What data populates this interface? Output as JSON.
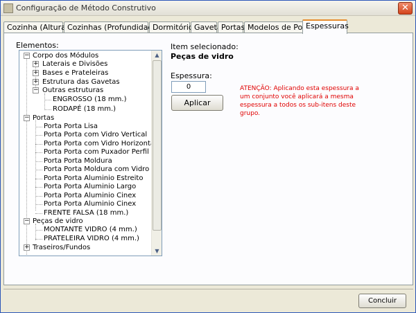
{
  "window": {
    "title": "Configuração de Método Construtivo",
    "close_glyph": "✕"
  },
  "tabs": [
    {
      "label": "Cozinha (Alturas)",
      "active": false
    },
    {
      "label": "Cozinhas (Profundidades)",
      "active": false
    },
    {
      "label": "Dormitórios",
      "active": false
    },
    {
      "label": "Gaveta",
      "active": false
    },
    {
      "label": "Portas",
      "active": false
    },
    {
      "label": "Modelos de Porta",
      "active": false
    },
    {
      "label": "Espessuras",
      "active": true
    }
  ],
  "elements": {
    "label": "Elementos:",
    "tree": [
      {
        "label": "Corpo dos Módulos",
        "expander": "−"
      },
      {
        "label": "Laterais e Divisões",
        "expander": "+"
      },
      {
        "label": "Bases e Prateleiras",
        "expander": "+"
      },
      {
        "label": "Estrutura das Gavetas",
        "expander": "+"
      },
      {
        "label": "Outras estruturas",
        "expander": "−"
      },
      {
        "label": "ENGROSSO (18 mm.)"
      },
      {
        "label": "RODAPÉ (18 mm.)"
      },
      {
        "label": "Portas",
        "expander": "−"
      },
      {
        "label": "Porta Porta Lisa"
      },
      {
        "label": "Porta Porta com Vidro Vertical"
      },
      {
        "label": "Porta Porta com Vidro Horizontal"
      },
      {
        "label": "Porta Porta com Puxador Perfil"
      },
      {
        "label": "Porta Porta Moldura"
      },
      {
        "label": "Porta Porta Moldura com Vidro"
      },
      {
        "label": "Porta Porta Aluminio Estreito"
      },
      {
        "label": "Porta Porta Aluminio Largo"
      },
      {
        "label": "Porta Porta Aluminio Cinex"
      },
      {
        "label": "Porta Porta Aluminio Cinex"
      },
      {
        "label": "FRENTE FALSA (18 mm.)"
      },
      {
        "label": "Peças de vidro",
        "expander": "−"
      },
      {
        "label": "MONTANTE VIDRO (4 mm.)"
      },
      {
        "label": "PRATELEIRA VIDRO (4 mm.)"
      },
      {
        "label": "Traseiros/Fundos",
        "expander": "+"
      }
    ],
    "scroll_up_glyph": "▲",
    "scroll_down_glyph": "▼"
  },
  "detail": {
    "selected_label": "Item selecionado:",
    "selected_value": "Peças de vidro",
    "thickness_label": "Espessura:",
    "thickness_value": "0",
    "apply_label": "Aplicar",
    "warning": "ATENÇÃO: Aplicando esta espessura a um conjunto você aplicará a mesma espessura a todos os sub-itens deste grupo."
  },
  "footer": {
    "done_label": "Concluir"
  }
}
